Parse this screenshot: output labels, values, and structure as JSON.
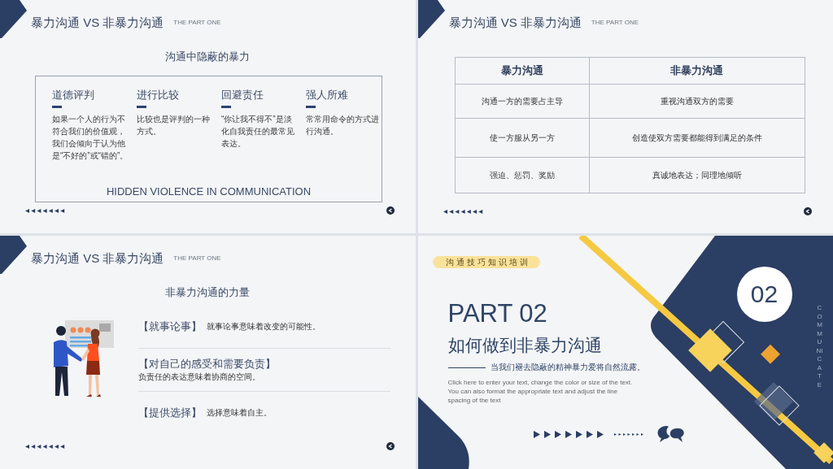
{
  "slides": [
    {
      "kind": "blocks",
      "header": {
        "title": "暴力沟通 VS 非暴力沟通",
        "subtitle": "THE PART ONE"
      },
      "heading": "沟通中隐蔽的暴力",
      "items": [
        {
          "title": "道德评判",
          "text": "如果一个人的行为不符合我们的价值观，我们会倾向于认为他是“不好的”或“错的”。"
        },
        {
          "title": "进行比较",
          "text": "比较也是评判的一种方式。"
        },
        {
          "title": "回避责任",
          "text": "“你让我不得不”是淡化自我责任的最常见表达。"
        },
        {
          "title": "强人所难",
          "text": "常常用命令的方式进行沟通。"
        }
      ],
      "caption": "HIDDEN VIOLENCE IN COMMUNICATION"
    },
    {
      "kind": "table",
      "header": {
        "title": "暴力沟通 VS 非暴力沟通",
        "subtitle": "THE PART ONE"
      },
      "table": {
        "columns": [
          "暴力沟通",
          "非暴力沟通"
        ],
        "rows": [
          [
            "沟通一方的需要占主导",
            "重视沟通双方的需要"
          ],
          [
            "使一方服从另一方",
            "创造使双方需要都能得到满足的条件"
          ],
          [
            "强迫、惩罚、奖励",
            "真诚地表达；同理地倾听"
          ]
        ]
      }
    },
    {
      "kind": "list",
      "header": {
        "title": "暴力沟通 VS 非暴力沟通",
        "subtitle": "THE PART ONE"
      },
      "heading": "非暴力沟通的力量",
      "items": [
        {
          "title": "【就事论事】",
          "text": "就事论事意味着改变的可能性。"
        },
        {
          "title": "【对自己的感受和需要负责】",
          "text": "负责任的表达意味着协商的空间。"
        },
        {
          "title": "【提供选择】",
          "text": "选择意味着自主。"
        }
      ]
    },
    {
      "kind": "cover",
      "tag": "沟通技巧知识培训",
      "part": "PART 02",
      "title": "如何做到非暴力沟通",
      "subtitle": "当我们褪去隐蔽的精神暴力爱将自然流露。",
      "body": "Click here to enter your text, change the color or size of the text. You can also format the appropriate text and adjust the line spacing of the text",
      "badge": "02",
      "vertical_text": "COMMUNICATE"
    }
  ]
}
